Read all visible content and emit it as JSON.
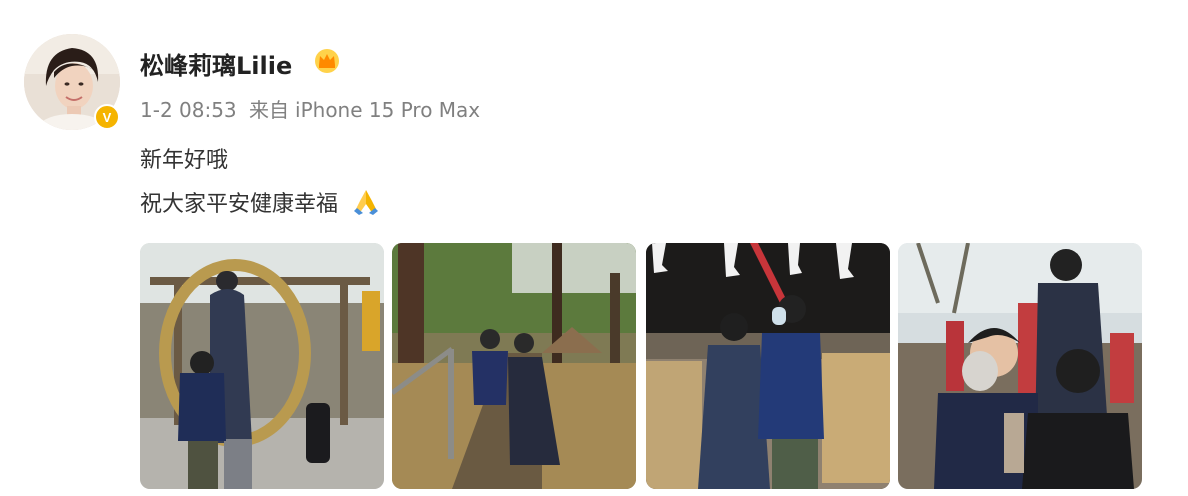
{
  "post": {
    "username": "松峰莉璃Lilie",
    "timestamp": "1-2 08:53",
    "source_prefix": "来自",
    "device": "iPhone 15 Pro Max",
    "text_line1": "新年好哦",
    "text_line2": "祝大家平安健康幸福",
    "verified_mark": "V",
    "icons": [
      "avatar",
      "verified-badge-icon",
      "vip-crown-icon",
      "praying-hands-icon"
    ],
    "photos": [
      "shrine-gate-photo",
      "forest-path-photo",
      "shrine-building-photo",
      "shrine-closeup-photo"
    ]
  },
  "colors": {
    "username": "#222222",
    "meta": "#808080",
    "body_text": "#333333",
    "verified": "#f5b400"
  }
}
